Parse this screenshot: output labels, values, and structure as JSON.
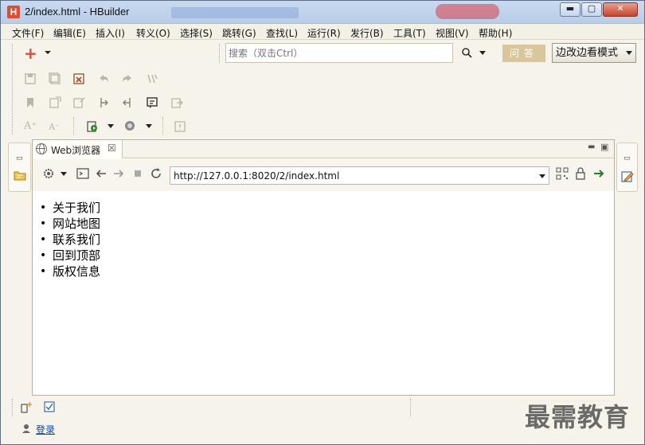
{
  "window": {
    "title": "2/index.html  -  HBuilder",
    "controls": {
      "min": "▬",
      "max": "▢",
      "close": "✕"
    }
  },
  "menu": [
    "文件(F)",
    "编辑(E)",
    "插入(I)",
    "转义(O)",
    "选择(S)",
    "跳转(G)",
    "查找(L)",
    "运行(R)",
    "发行(B)",
    "工具(T)",
    "视图(V)",
    "帮助(H)"
  ],
  "toolbar": {
    "new_label": "+",
    "search_placeholder": "搜索（双击Ctrl）",
    "ask_label": "问答",
    "mode_label": "边改边看模式"
  },
  "view": {
    "tab_label": "Web浏览器",
    "tab_close": "☒",
    "url": "http://127.0.0.1:8020/2/index.html"
  },
  "page": {
    "items": [
      "关于我们",
      "网站地图",
      "联系我们",
      "回到顶部",
      "版权信息"
    ]
  },
  "footer": {
    "login": "登录"
  },
  "watermark": "最需教育",
  "colors": {
    "titlebar": "#c9daf0",
    "accent_red": "#e24b2b",
    "ask_button": "#d9c79b",
    "link": "#0645ad",
    "green_arrow": "#2a7a2a"
  }
}
